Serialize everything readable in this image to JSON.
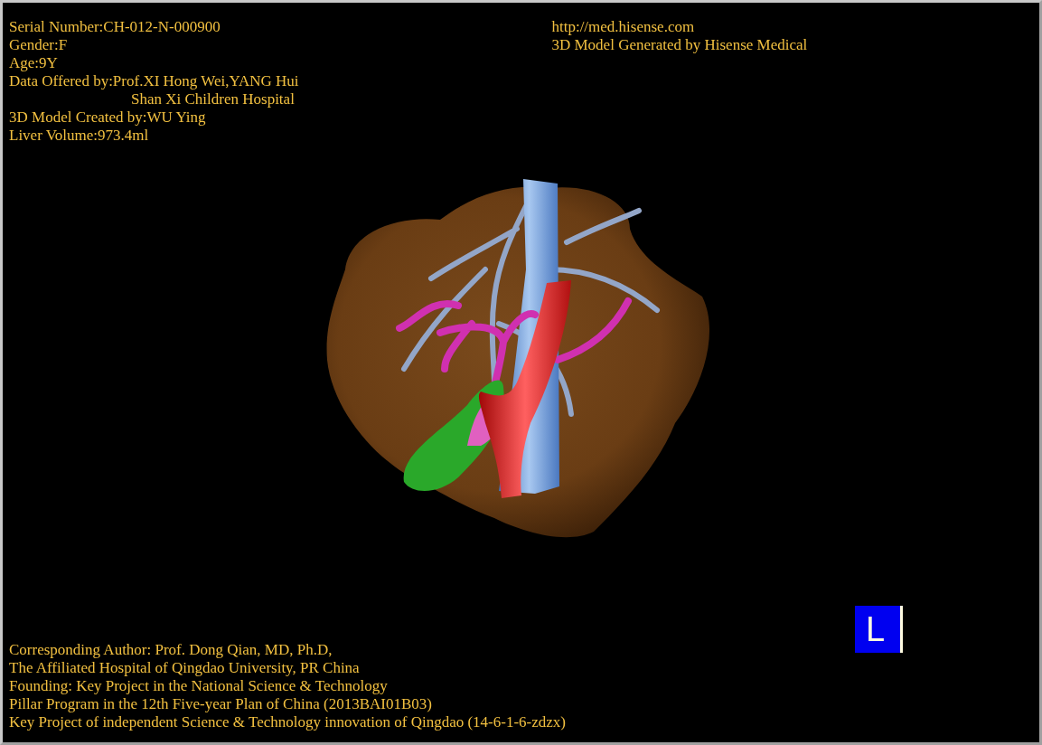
{
  "patient_info": [
    {
      "text": "Serial Number:CH-012-N-000900",
      "kind": "line"
    },
    {
      "text": "Gender:F",
      "kind": "line"
    },
    {
      "text": "Age:9Y",
      "kind": "line"
    },
    {
      "text": "Data Offered by:Prof.XI Hong Wei,YANG Hui",
      "kind": "line"
    },
    {
      "text": "Shan Xi Children Hospital",
      "kind": "continuation"
    },
    {
      "text": "3D Model Created by:WU Ying",
      "kind": "line"
    },
    {
      "text": "Liver Volume:973.4ml",
      "kind": "line"
    }
  ],
  "vendor_info": [
    "http://med.hisense.com",
    "3D Model Generated by Hisense Medical"
  ],
  "orientation_marker": {
    "label": "L"
  },
  "credits": [
    "Corresponding Author: Prof. Dong Qian, MD, Ph.D,",
    "The Affiliated Hospital of Qingdao University, PR China",
    "Founding: Key Project in the National Science & Technology",
    "Pillar Program in the 12th Five-year Plan of China (2013BAI01B03)",
    "Key Project of independent Science & Technology innovation of Qingdao (14-6-1-6-zdzx)"
  ]
}
